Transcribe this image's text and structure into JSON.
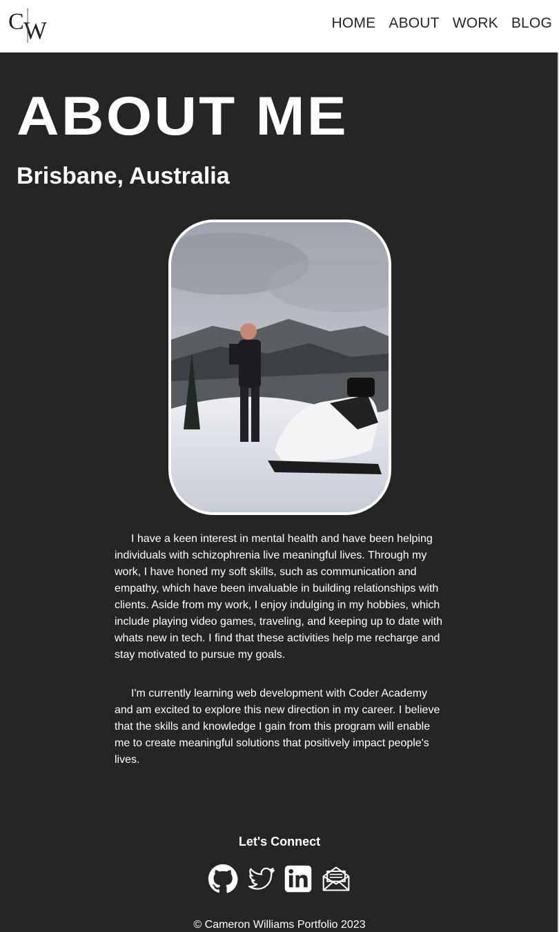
{
  "header": {
    "logo_icon": "cw-monogram-logo",
    "nav": [
      "HOME",
      "ABOUT",
      "WORK",
      "BLOG"
    ]
  },
  "main": {
    "title": "ABOUT ME",
    "location": "Brisbane, Australia",
    "photo_icon": "profile-photo-snowmobile",
    "bio": [
      "I have a keen interest in mental health and have been helping individuals with schizophrenia live meaningful lives. Through my work, I have honed my soft skills, such as communication and empathy, which have been invaluable in building relationships with clients. Aside from my work, I enjoy indulging in my hobbies, which include playing video games, traveling, and keeping up to date with whats new in tech. I find that these activities help me recharge and stay motivated to pursue my goals.",
      "I'm currently learning web development with Coder Academy and am excited to explore this new direction in my career. I believe that the skills and knowledge I gain from this program will enable me to create meaningful solutions that positively impact people's lives."
    ]
  },
  "connect": {
    "heading": "Let's Connect",
    "links": [
      "github-icon",
      "twitter-icon",
      "linkedin-icon",
      "email-icon"
    ]
  },
  "footer": {
    "text": "© Cameron Williams Portfolio 2023"
  },
  "colors": {
    "background": "#252525",
    "header": "#ffffff",
    "nav_text": "#262626",
    "text": "#ffffff"
  }
}
